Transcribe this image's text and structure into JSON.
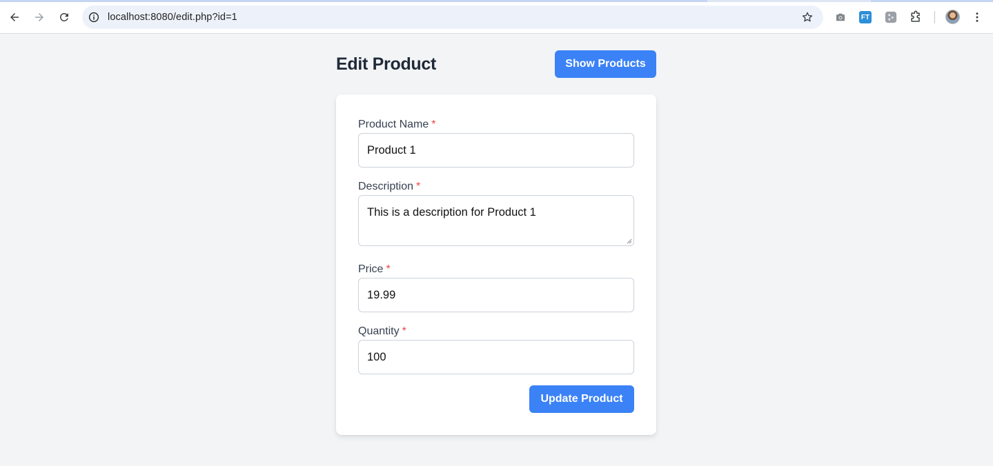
{
  "browser": {
    "url": "localhost:8080/edit.php?id=1",
    "icons": [
      "back-arrow-icon",
      "forward-arrow-icon",
      "reload-icon",
      "info-icon",
      "star-icon",
      "camera-icon",
      "extension-ft-icon",
      "extension-puzzle-piece-icon",
      "extensions-icon",
      "profile-avatar",
      "more-vert-icon"
    ],
    "extension_ft_label": "FT"
  },
  "header": {
    "title": "Edit Product",
    "show_products_label": "Show Products"
  },
  "form": {
    "fields": [
      {
        "label": "Product Name",
        "required_mark": "*",
        "value": "Product 1"
      },
      {
        "label": "Description",
        "required_mark": "*",
        "value": "This is a description for Product 1"
      },
      {
        "label": "Price",
        "required_mark": "*",
        "value": "19.99"
      },
      {
        "label": "Quantity",
        "required_mark": "*",
        "value": "100"
      }
    ],
    "submit_label": "Update Product"
  },
  "colors": {
    "primary": "#3b82f6",
    "required": "#ef4444",
    "page_bg": "#f3f4f6",
    "title": "#1f2937"
  }
}
